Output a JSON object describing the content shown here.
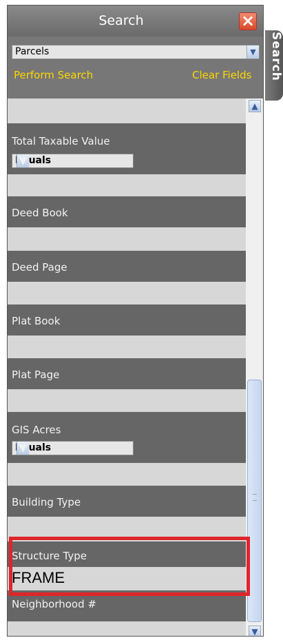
{
  "panel": {
    "title": "Search",
    "close_icon": "close-icon"
  },
  "layer_select": {
    "value": "Parcels",
    "arrow_icon": "chevron-down-icon"
  },
  "actions": {
    "perform": "Perform Search",
    "clear": "Clear Fields"
  },
  "side_tab": {
    "label": "Search"
  },
  "fields": {
    "total_taxable_value": {
      "label": "Total Taxable Value",
      "operator": "Equals"
    },
    "deed_book": {
      "label": "Deed Book"
    },
    "deed_page": {
      "label": "Deed Page"
    },
    "plat_book": {
      "label": "Plat Book"
    },
    "plat_page": {
      "label": "Plat Page"
    },
    "gis_acres": {
      "label": "GIS Acres",
      "operator": "Equals"
    },
    "building_type": {
      "label": "Building Type"
    },
    "structure_type": {
      "label": "Structure Type",
      "value": "FRAME"
    },
    "neighborhood": {
      "label": "Neighborhood #"
    }
  },
  "colors": {
    "accent_link": "#ffd700",
    "highlight": "#e0252a",
    "label_bg": "#666666",
    "field_bg": "#d7d7d7"
  }
}
